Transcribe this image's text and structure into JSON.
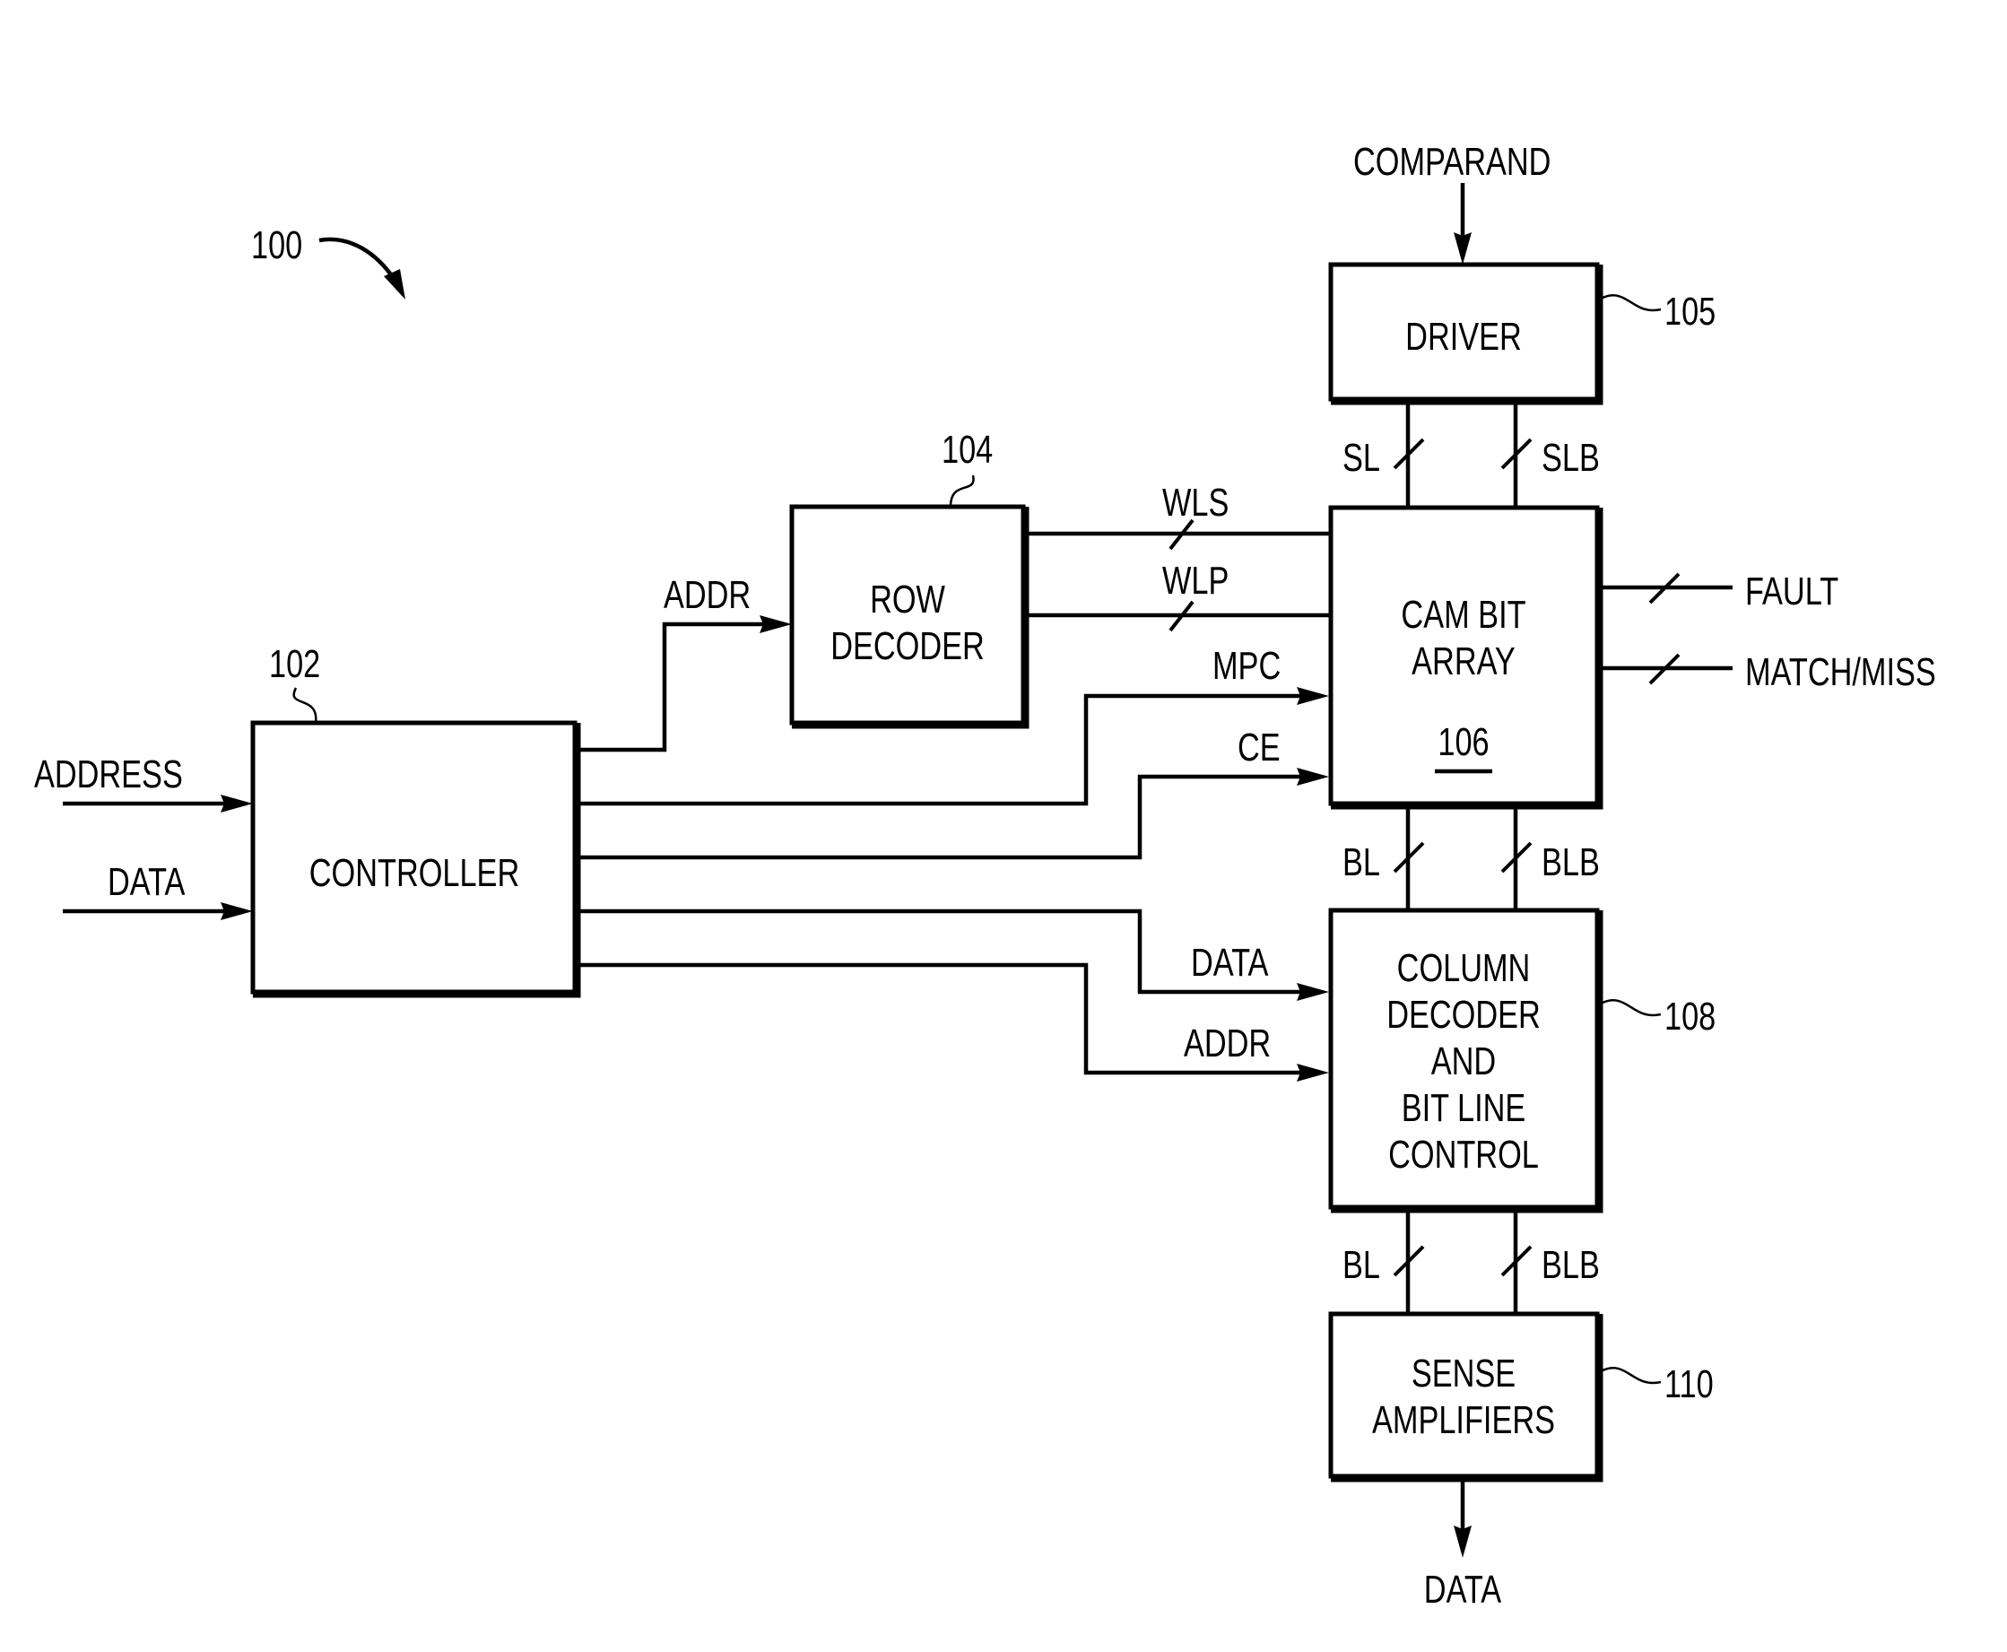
{
  "figure": {
    "reference": "100",
    "blocks": {
      "controller": {
        "ref": "102",
        "lines": [
          "CONTROLLER"
        ]
      },
      "row_decoder": {
        "ref": "104",
        "lines": [
          "ROW",
          "DECODER"
        ]
      },
      "driver": {
        "ref": "105",
        "lines": [
          "DRIVER"
        ]
      },
      "cam_bit_array": {
        "ref": "106",
        "lines": [
          "CAM BIT",
          "ARRAY"
        ]
      },
      "column_decoder": {
        "ref": "108",
        "lines": [
          "COLUMN",
          "DECODER",
          "AND",
          "BIT LINE",
          "CONTROL"
        ]
      },
      "sense_amplifiers": {
        "ref": "110",
        "lines": [
          "SENSE",
          "AMPLIFIERS"
        ]
      }
    },
    "signals": {
      "address_in": "ADDRESS",
      "data_in": "DATA",
      "addr_to_row_decoder": "ADDR",
      "wls": "WLS",
      "wlp": "WLP",
      "mpc": "MPC",
      "ce": "CE",
      "data_to_column": "DATA",
      "addr_to_column": "ADDR",
      "comparand": "COMPARAND",
      "sl": "SL",
      "slb": "SLB",
      "bl_upper": "BL",
      "blb_upper": "BLB",
      "bl_lower": "BL",
      "blb_lower": "BLB",
      "fault": "FAULT",
      "match_miss": "MATCH/MISS",
      "data_out": "DATA"
    }
  }
}
